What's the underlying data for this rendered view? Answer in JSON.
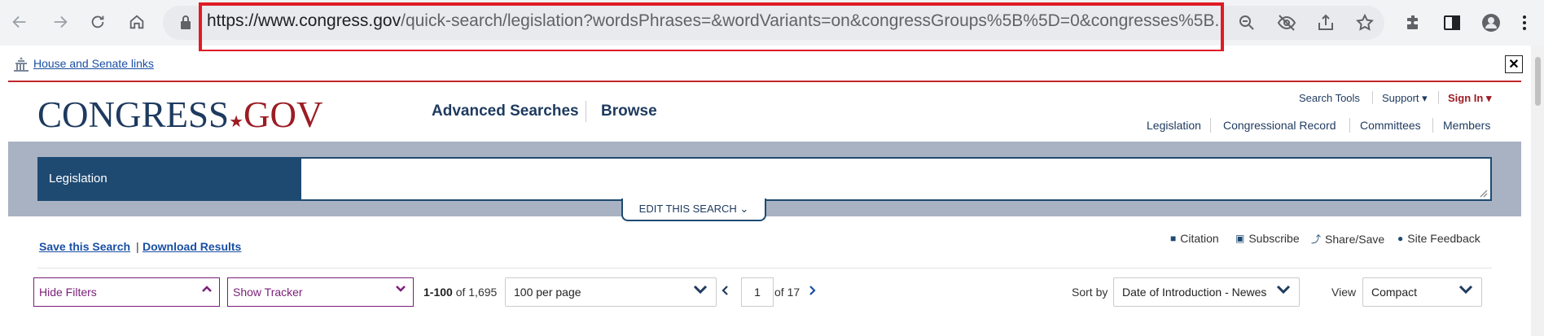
{
  "browser": {
    "url_host": "https://www.congress.gov",
    "url_path": "/quick-search/legislation?wordsPhrases=&wordVariants=on&congressGroups%5B%5D=0&congresses%5B..."
  },
  "notice": {
    "link_text": "House and Senate links",
    "close": "✕"
  },
  "header": {
    "logo_main": "CONGRESS",
    "logo_dot": "★",
    "logo_gov": "GOV",
    "nav": {
      "advanced": "Advanced Searches",
      "browse": "Browse"
    },
    "util": {
      "search_tools": "Search Tools",
      "support": "Support ▾",
      "sign_in": "Sign In ▾"
    },
    "sections": [
      "Legislation",
      "Congressional Record",
      "Committees",
      "Members"
    ]
  },
  "search": {
    "label": "Legislation",
    "value": "",
    "edit": "EDIT THIS SEARCH ⌄"
  },
  "actions": {
    "save": "Save this Search",
    "pipe": "|",
    "download": "Download Results",
    "tools": [
      {
        "icon": "■",
        "label": "Citation"
      },
      {
        "icon": "▣",
        "label": "Subscribe"
      },
      {
        "icon": "⤴",
        "label": "Share/Save"
      },
      {
        "icon": "●",
        "label": "Site Feedback"
      }
    ]
  },
  "filters": {
    "hide_filters": "Hide Filters",
    "show_tracker": "Show Tracker",
    "results_range": "1-100",
    "results_of": "of 1,695",
    "per_page": "100 per page",
    "page_current": "1",
    "page_of": "of 17",
    "sort_label": "Sort by",
    "sort_value": "Date of Introduction - Newes",
    "view_label": "View",
    "view_value": "Compact"
  },
  "colors": {
    "brand_blue": "#1e3a5f",
    "brand_red": "#9c1c24",
    "filter_purple": "#7b1e7a",
    "highlight_red": "#e01b24"
  }
}
